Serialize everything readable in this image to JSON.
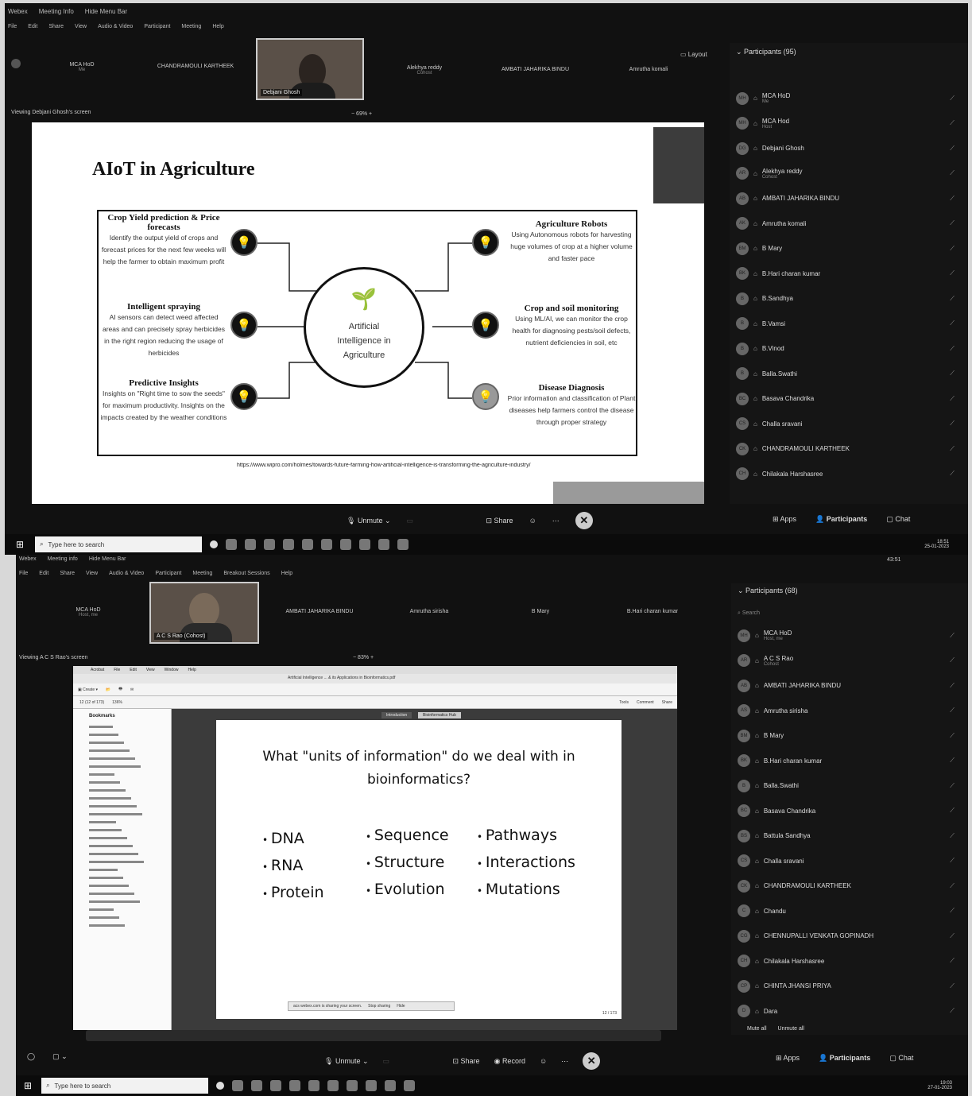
{
  "top": {
    "window_menu": [
      "Webex",
      "Meeting Info",
      "Hide Menu Bar"
    ],
    "menubar": [
      "File",
      "Edit",
      "Share",
      "View",
      "Audio & Video",
      "Participant",
      "Meeting",
      "Help"
    ],
    "thumbnails": [
      {
        "name": "MCA HoD",
        "sub": "Me"
      },
      {
        "name": "CHANDRAMOULI KARTHEEK",
        "sub": ""
      },
      {
        "name": "Alekhya reddy",
        "sub": "Cohost"
      },
      {
        "name": "AMBATI JAHARIKA BINDU",
        "sub": ""
      },
      {
        "name": "Amrutha komali",
        "sub": ""
      }
    ],
    "active_video_label": "Debjani Ghosh",
    "layout_label": "Layout",
    "viewing_label": "Viewing Debjani Ghosh's screen",
    "zoom": "69%",
    "slide": {
      "title": "AIoT in Agriculture",
      "center_label": "Artificial Intelligence in Agriculture",
      "left": [
        {
          "title": "Crop Yield prediction & Price forecasts",
          "body": "Identify the output yield of crops and forecast prices for the next few weeks will help the farmer to obtain maximum profit"
        },
        {
          "title": "Intelligent spraying",
          "body": "AI sensors can detect weed affected areas and can precisely spray herbicides in the right region reducing the usage of herbicides"
        },
        {
          "title": "Predictive Insights",
          "body": "Insights on \"Right time to sow the seeds\" for maximum productivity. Insights on the impacts created by the weather conditions"
        }
      ],
      "right": [
        {
          "title": "Agriculture Robots",
          "body": "Using Autonomous robots for harvesting huge volumes of crop at a higher volume and faster pace"
        },
        {
          "title": "Crop and soil monitoring",
          "body": "Using ML/AI, we can monitor the crop health for diagnosing pests/soil defects, nutrient deficiencies in soil, etc"
        },
        {
          "title": "Disease Diagnosis",
          "body": "Prior information and classification of Plant diseases help farmers control the disease through proper strategy"
        }
      ],
      "url": "https://www.wipro.com/holmes/towards-future-farming-how-artificial-intelligence-is-transforming-the-agriculture-industry/"
    },
    "participants_title": "Participants (95)",
    "participants": [
      {
        "initials": "MH",
        "name": "MCA HoD",
        "sub": "Me"
      },
      {
        "initials": "MH",
        "name": "MCA Hod",
        "sub": "Host"
      },
      {
        "initials": "DG",
        "name": "Debjani Ghosh",
        "sub": ""
      },
      {
        "initials": "AR",
        "name": "Alekhya reddy",
        "sub": "Cohost"
      },
      {
        "initials": "AB",
        "name": "AMBATI JAHARIKA BINDU",
        "sub": ""
      },
      {
        "initials": "AK",
        "name": "Amrutha komali",
        "sub": ""
      },
      {
        "initials": "BM",
        "name": "B Mary",
        "sub": ""
      },
      {
        "initials": "BK",
        "name": "B.Hari charan kumar",
        "sub": ""
      },
      {
        "initials": "B",
        "name": "B.Sandhya",
        "sub": ""
      },
      {
        "initials": "B",
        "name": "B.Vamsi",
        "sub": ""
      },
      {
        "initials": "B",
        "name": "B.Vinod",
        "sub": ""
      },
      {
        "initials": "B",
        "name": "Balla.Swathi",
        "sub": ""
      },
      {
        "initials": "BC",
        "name": "Basava Chandrika",
        "sub": ""
      },
      {
        "initials": "CS",
        "name": "Challa sravani",
        "sub": ""
      },
      {
        "initials": "CK",
        "name": "CHANDRAMOULI KARTHEEK",
        "sub": ""
      },
      {
        "initials": "CH",
        "name": "Chilakala Harshasree",
        "sub": ""
      }
    ],
    "controls": {
      "unmute": "Unmute",
      "share": "Share",
      "apps": "Apps",
      "participants": "Participants",
      "chat": "Chat"
    },
    "taskbar": {
      "search_placeholder": "Type here to search",
      "time": "18:51",
      "date": "25-01-2023"
    }
  },
  "bottom": {
    "window_menu": [
      "Webex",
      "Meeting info",
      "Hide Menu Bar"
    ],
    "menubar": [
      "File",
      "Edit",
      "Share",
      "View",
      "Audio & Video",
      "Participant",
      "Meeting",
      "Breakout Sessions",
      "Help"
    ],
    "clock": "43:51",
    "thumbnails": [
      {
        "name": "MCA HoD",
        "sub": "Host, me"
      },
      {
        "name": "AMBATI JAHARIKA BINDU",
        "sub": ""
      },
      {
        "name": "Amrutha sirisha",
        "sub": ""
      },
      {
        "name": "B Mary",
        "sub": ""
      },
      {
        "name": "B.Hari charan kumar",
        "sub": ""
      }
    ],
    "active_video_label": "A C S Rao (Cohost)",
    "viewing_label": "Viewing A C S Rao's screen",
    "zoom": "83%",
    "acrobat": {
      "menu": [
        "Acrobat",
        "File",
        "Edit",
        "View",
        "Window",
        "Help"
      ],
      "doc_title": "Artificial Intelligence ... & its Applications in Bioinformatics.pdf",
      "create": "Create",
      "page_field": "12 (12 of 173)",
      "zoom_field": "136%",
      "tools": "Tools",
      "comment": "Comment",
      "share": "Share",
      "bookmarks_label": "Bookmarks",
      "tabs": [
        "Introduction",
        "Bioinformatics Hub"
      ],
      "page_counter": "12 / 173",
      "sharing_notice": "acs webex.com is sharing your screen.",
      "stop_sharing": "Stop sharing",
      "hide": "Hide"
    },
    "slide": {
      "question": "What \"units of information\" do we deal with in bioinformatics?",
      "columns": [
        [
          "DNA",
          "RNA",
          "Protein"
        ],
        [
          "Sequence",
          "Structure",
          "Evolution"
        ],
        [
          "Pathways",
          "Interactions",
          "Mutations"
        ]
      ]
    },
    "participants_title": "Participants (68)",
    "search_placeholder": "Search",
    "participants": [
      {
        "initials": "MH",
        "name": "MCA HoD",
        "sub": "Host, me"
      },
      {
        "initials": "AR",
        "name": "A C S Rao",
        "sub": "Cohost"
      },
      {
        "initials": "AB",
        "name": "AMBATI JAHARIKA BINDU",
        "sub": ""
      },
      {
        "initials": "AS",
        "name": "Amrutha sirisha",
        "sub": ""
      },
      {
        "initials": "BM",
        "name": "B Mary",
        "sub": ""
      },
      {
        "initials": "BK",
        "name": "B.Hari charan kumar",
        "sub": ""
      },
      {
        "initials": "B",
        "name": "Balla.Swathi",
        "sub": ""
      },
      {
        "initials": "BC",
        "name": "Basava Chandrika",
        "sub": ""
      },
      {
        "initials": "BS",
        "name": "Battula Sandhya",
        "sub": ""
      },
      {
        "initials": "CS",
        "name": "Challa sravani",
        "sub": ""
      },
      {
        "initials": "CK",
        "name": "CHANDRAMOULI KARTHEEK",
        "sub": ""
      },
      {
        "initials": "C",
        "name": "Chandu",
        "sub": ""
      },
      {
        "initials": "CG",
        "name": "CHENNUPALLI VENKATA GOPINADH",
        "sub": ""
      },
      {
        "initials": "CH",
        "name": "Chilakala Harshasree",
        "sub": ""
      },
      {
        "initials": "CP",
        "name": "CHINTA JHANSI PRIYA",
        "sub": ""
      },
      {
        "initials": "D",
        "name": "Dara",
        "sub": ""
      }
    ],
    "mute_all": "Mute all",
    "unmute_all": "Unmute all",
    "controls": {
      "unmute": "Unmute",
      "share": "Share",
      "record": "Record",
      "apps": "Apps",
      "participants": "Participants",
      "chat": "Chat"
    },
    "taskbar": {
      "search_placeholder": "Type here to search",
      "time": "19:03",
      "date": "27-01-2023"
    }
  }
}
